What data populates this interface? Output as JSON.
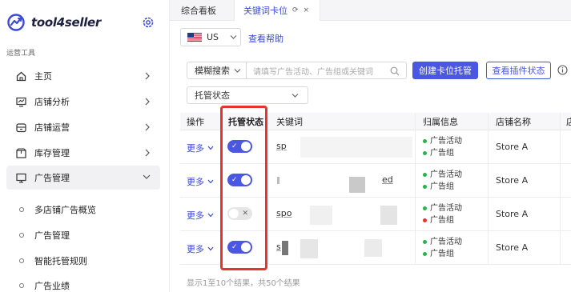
{
  "app": {
    "name": "tool4seller"
  },
  "sidebar": {
    "section_label": "运营工具",
    "items": [
      {
        "label": "主页",
        "icon": "home-icon"
      },
      {
        "label": "店铺分析",
        "icon": "chart-icon"
      },
      {
        "label": "店铺运营",
        "icon": "store-icon"
      },
      {
        "label": "库存管理",
        "icon": "box-icon"
      },
      {
        "label": "广告管理",
        "icon": "monitor-icon"
      }
    ],
    "subitems": [
      "多店铺广告概览",
      "广告管理",
      "智能托管规则",
      "广告业绩"
    ]
  },
  "tabs": [
    {
      "label": "综合看板"
    },
    {
      "label": "关键词卡位",
      "refresh": "⟳",
      "close": "×"
    }
  ],
  "toolbar": {
    "country": "US",
    "help": "查看帮助"
  },
  "filters": {
    "search_mode": "模糊搜索",
    "search_placeholder": "请填写广告活动、广告组或关键词",
    "create_button": "创建卡位托管",
    "plugin_button": "查看插件状态",
    "status_select": "托管状态"
  },
  "table": {
    "headers": [
      "操作",
      "托管状态",
      "关键词",
      "归属信息",
      "店铺名称",
      "店"
    ],
    "rows": [
      {
        "action": "更多",
        "enabled": true,
        "keyword": "sp",
        "attr": [
          "广告活动",
          "广告组"
        ],
        "attr_colors": [
          "#2bb24c",
          "#2bb24c"
        ],
        "store": "Store A"
      },
      {
        "action": "更多",
        "enabled": true,
        "keyword": "ed",
        "attr": [
          "广告活动",
          "广告组"
        ],
        "attr_colors": [
          "#2bb24c",
          "#2bb24c"
        ],
        "store": "Store A"
      },
      {
        "action": "更多",
        "enabled": false,
        "keyword": "spo",
        "attr": [
          "广告活动",
          "广告组"
        ],
        "attr_colors": [
          "#2bb24c",
          "#e5322d"
        ],
        "store": "Store A"
      },
      {
        "action": "更多",
        "enabled": true,
        "keyword": "s",
        "attr": [
          "广告活动",
          "广告组"
        ],
        "attr_colors": [
          "#2bb24c",
          "#2bb24c"
        ],
        "store": "Store A"
      }
    ]
  },
  "footer": {
    "summary": "显示1至10个结果，共50个结果"
  },
  "colors": {
    "accent": "#4a57e0",
    "highlight": "#e8322f",
    "active_green": "#2bb24c",
    "inactive_red": "#e5322d"
  }
}
